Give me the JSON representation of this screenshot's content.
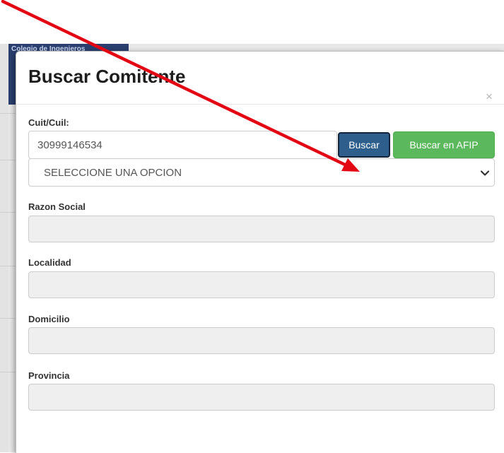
{
  "background": {
    "header_text": "Colegio de Ingenieros"
  },
  "modal": {
    "title": "Buscar Comitente",
    "close_symbol": "×",
    "cuit": {
      "label": "Cuit/Cuil:",
      "value": "30999146534"
    },
    "buttons": {
      "buscar": "Buscar",
      "buscar_afip": "Buscar en AFIP"
    },
    "select": {
      "selected": "SELECCIONE UNA OPCION",
      "icon": "chevron-down-icon"
    },
    "fields": {
      "razon_social": {
        "label": "Razon Social",
        "value": ""
      },
      "localidad": {
        "label": "Localidad",
        "value": ""
      },
      "domicilio": {
        "label": "Domicilio",
        "value": ""
      },
      "provincia": {
        "label": "Provincia",
        "value": ""
      }
    }
  },
  "colors": {
    "buscar_button": "#2e5f8c",
    "afip_button": "#5cb85c",
    "annotation_arrow": "#e30613"
  }
}
